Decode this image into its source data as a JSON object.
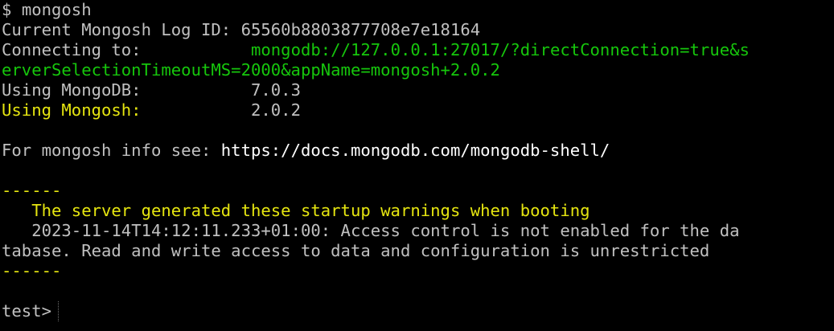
{
  "prompt_symbol": "$",
  "command": "mongosh",
  "log_label": "Current Mongosh Log ID:",
  "log_id": "65560b8803877708e7e18164",
  "connecting_label": "Connecting to:",
  "connection_uri_line1": "mongodb://127.0.0.1:27017/?directConnection=true&s",
  "connection_uri_line2": "erverSelectionTimeoutMS=2000&appName=mongosh+2.0.2",
  "mongodb_label": "Using MongoDB:",
  "mongodb_version": "7.0.3",
  "mongosh_label": "Using Mongosh:",
  "mongosh_version": "2.0.2",
  "info_label": "For mongosh info see:",
  "info_url": "https://docs.mongodb.com/mongodb-shell/",
  "warning_separator": "------",
  "warning_title": "The server generated these startup warnings when booting",
  "warning_line1": "2023-11-14T14:12:11.233+01:00: Access control is not enabled for the da",
  "warning_line2": "tabase. Read and write access to data and configuration is unrestricted",
  "shell_prompt": "test>",
  "colors": {
    "background": "#000000",
    "text": "#c0c0c0",
    "bright": "#ffffff",
    "uri": "#16c60c",
    "warning": "#e5e510"
  }
}
